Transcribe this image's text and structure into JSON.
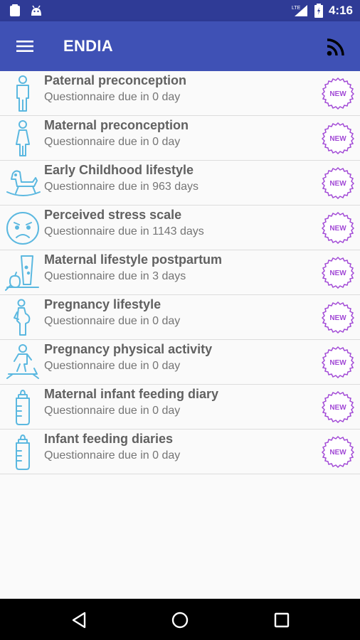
{
  "status_bar": {
    "time": "4:16",
    "network": "LTE",
    "left_icons": [
      "clipboard-icon",
      "android-icon"
    ]
  },
  "app_bar": {
    "title": "ENDIA",
    "menu_icon": "hamburger-menu-icon",
    "action_icon": "rss-feed-icon"
  },
  "colors": {
    "status_bar": "#2f3b96",
    "app_bar": "#3f51b5",
    "icon_blue": "#5bb8e0",
    "badge_purple": "#a24ad6"
  },
  "questionnaires": [
    {
      "title": "Paternal preconception",
      "due": "Questionnaire due in 0 day",
      "icon": "man-icon",
      "badge": "NEW"
    },
    {
      "title": "Maternal preconception",
      "due": "Questionnaire due in 0 day",
      "icon": "woman-icon",
      "badge": "NEW"
    },
    {
      "title": "Early Childhood lifestyle",
      "due": "Questionnaire due in 963 days",
      "icon": "rocking-horse-icon",
      "badge": "NEW"
    },
    {
      "title": "Perceived stress scale",
      "due": "Questionnaire due in 1143 days",
      "icon": "stressed-face-icon",
      "badge": "NEW"
    },
    {
      "title": "Maternal lifestyle postpartum",
      "due": "Questionnaire due in 3 days",
      "icon": "glass-and-apple-icon",
      "badge": "NEW"
    },
    {
      "title": "Pregnancy lifestyle",
      "due": "Questionnaire due in 0 day",
      "icon": "pregnant-woman-icon",
      "badge": "NEW"
    },
    {
      "title": "Pregnancy physical activity",
      "due": "Questionnaire due in 0 day",
      "icon": "treadmill-icon",
      "badge": "NEW"
    },
    {
      "title": "Maternal infant feeding diary",
      "due": "Questionnaire due in 0 day",
      "icon": "baby-bottle-icon",
      "badge": "NEW"
    },
    {
      "title": "Infant feeding diaries",
      "due": "Questionnaire due in 0 day",
      "icon": "baby-bottle-icon",
      "badge": "NEW"
    }
  ],
  "nav_bar": {
    "buttons": [
      "back-icon",
      "home-icon",
      "recents-icon"
    ]
  }
}
